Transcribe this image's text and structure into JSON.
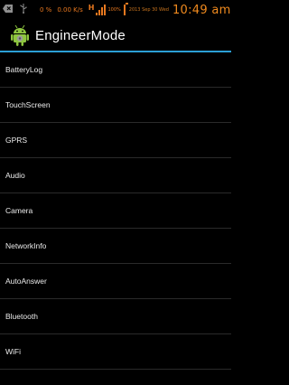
{
  "status_bar": {
    "network_percent": "0 %",
    "network_speed": "0.00 K/s",
    "network_type": "H",
    "battery_percent": "100%",
    "battery_level": 1.0,
    "date": "2013 Sep 30 Wed",
    "time": "10:49 am",
    "accent_color": "#e8781f",
    "icons": [
      "back-icon",
      "usb-icon",
      "signal-icon",
      "battery-icon"
    ]
  },
  "action_bar": {
    "title": "EngineerMode",
    "icon": "android-robot-icon",
    "divider_color": "#2b9fd6"
  },
  "menu": {
    "items": [
      {
        "label": "BatteryLog"
      },
      {
        "label": "TouchScreen"
      },
      {
        "label": "GPRS"
      },
      {
        "label": "Audio"
      },
      {
        "label": "Camera"
      },
      {
        "label": "NetworkInfo"
      },
      {
        "label": "AutoAnswer"
      },
      {
        "label": "Bluetooth"
      },
      {
        "label": "WiFi"
      }
    ]
  }
}
